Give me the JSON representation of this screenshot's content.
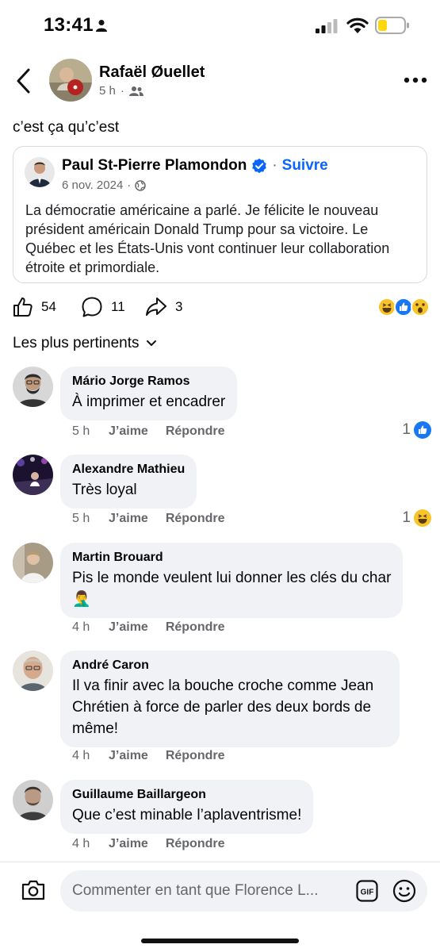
{
  "status_bar": {
    "time": "13:41",
    "icons": [
      "person-icon",
      "signal-icon",
      "wifi-icon",
      "battery-low-icon"
    ]
  },
  "post": {
    "author": "Rafaël Øuellet",
    "time": "5 h",
    "audience_icon": "friends-icon",
    "text": "c’est ça qu’c’est"
  },
  "shared_post": {
    "author": "Paul St-Pierre Plamondon",
    "verified": true,
    "separator": "·",
    "follow": "Suivre",
    "date": "6 nov. 2024",
    "date_separator": "·",
    "audience_icon": "globe-icon",
    "text": "La démocratie américaine a parlé. Je félicite le nouveau président américain Donald Trump pour sa victoire. Le Québec et les États-Unis vont continuer leur collaboration étroite et primordiale."
  },
  "engagement": {
    "likes": "54",
    "comments": "11",
    "shares": "3",
    "reaction_types": [
      "haha",
      "like",
      "wow"
    ]
  },
  "sort_label": "Les plus pertinents",
  "comments": [
    {
      "name": "Mário Jorge Ramos",
      "text": "À imprimer et encadrer",
      "time": "5 h",
      "like": "J’aime",
      "reply": "Répondre",
      "reaction_count": "1",
      "reaction": "like"
    },
    {
      "name": "Alexandre Mathieu",
      "text": "Très loyal",
      "time": "5 h",
      "like": "J’aime",
      "reply": "Répondre",
      "reaction_count": "1",
      "reaction": "haha"
    },
    {
      "name": "Martin Brouard",
      "text": "Pis le monde veulent lui donner les clés du char",
      "emoji": "🤦‍♂️",
      "time": "4 h",
      "like": "J’aime",
      "reply": "Répondre"
    },
    {
      "name": "André Caron",
      "text": "Il va finir avec la bouche croche comme Jean Chrétien à force de parler des deux bords de même!",
      "time": "4 h",
      "like": "J’aime",
      "reply": "Répondre"
    },
    {
      "name": "Guillaume Baillargeon",
      "text": "Que c’est minable l’aplaventrisme!",
      "time": "4 h",
      "like": "J’aime",
      "reply": "Répondre"
    }
  ],
  "composer": {
    "placeholder": "Commenter en tant que Florence L..."
  },
  "colors": {
    "accent": "#0866ff",
    "secondary_text": "#65676b",
    "bubble": "#f0f2f5",
    "battery": "#ffd60a"
  }
}
